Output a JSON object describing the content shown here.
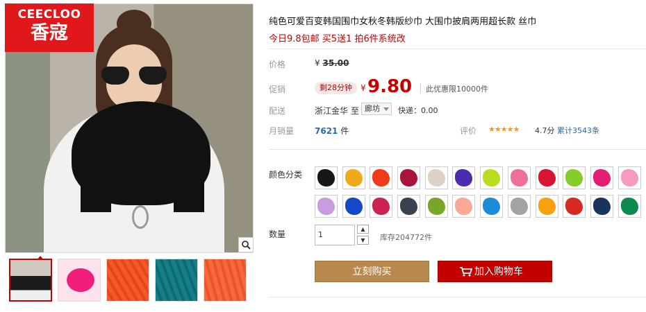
{
  "brand": {
    "name_en": "CEECLOO",
    "name_cn": "香寇"
  },
  "product": {
    "title": "纯色可爱百变韩国围巾女秋冬韩版纱巾 大围巾披肩两用超长款 丝巾",
    "subtitle": "今日9.8包邮 买5送1 拍6件系统改"
  },
  "labels": {
    "price": "价格",
    "promo": "促销",
    "shipping": "配送",
    "monthly_sales": "月销量",
    "rating": "评价",
    "color": "颜色分类",
    "quantity": "数量"
  },
  "price": {
    "currency": "¥",
    "original": "35.00",
    "promo_tag": "剩28分钟",
    "promo": "9.80",
    "promo_note": "此优惠限10000件"
  },
  "shipping": {
    "from": "浙江金华",
    "to_label": "至",
    "destination": "廊坊",
    "fee": "快递：0.00"
  },
  "sales": {
    "count": "7621",
    "unit": "件"
  },
  "rating": {
    "stars": "★★★★★",
    "score": "4.7分",
    "reviews": "累计3543条"
  },
  "colors": [
    "#171717",
    "#f2a81d",
    "#ee3b18",
    "#a8143a",
    "#ddd0c4",
    "#4b2bb0",
    "#b9dc1f",
    "#f06f98",
    "#d81531",
    "#84cd2b",
    "#e21d74",
    "#f59ac0",
    "#c99be0",
    "#1448c8",
    "#cc2252",
    "#3a4150",
    "#78a626",
    "#f7a996",
    "#1d8cd8",
    "#a3a3a3",
    "#f9a111",
    "#d82a22",
    "#17345f",
    "#0d8a4c"
  ],
  "quantity": {
    "value": "1",
    "stock": "库存204772件"
  },
  "actions": {
    "buy_now": "立刻购买",
    "add_cart": "加入购物车"
  },
  "thumbs": [
    "#444444",
    "#f0207a",
    "#f35a28",
    "#168089",
    "#f56a3c"
  ],
  "icons": {
    "zoom": "magnifier-icon",
    "cart": "cart-icon"
  }
}
